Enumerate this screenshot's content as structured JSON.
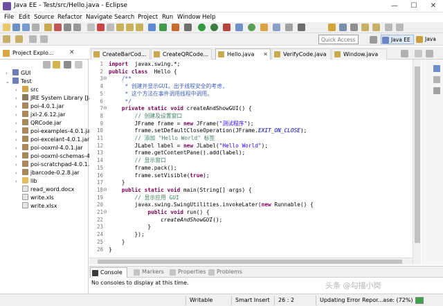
{
  "window": {
    "title": "Java EE - Test/src/Hello.java - Eclipse",
    "min": "—",
    "max": "☐",
    "close": "✕"
  },
  "menu": [
    "File",
    "Edit",
    "Source",
    "Refactor",
    "Navigate",
    "Search",
    "Project",
    "Run",
    "Window",
    "Help"
  ],
  "toolbar": {
    "quick_access_placeholder": "Quick Access",
    "perspectives": [
      "Java EE",
      "Java"
    ]
  },
  "package_explorer": {
    "title": "Project Explo...",
    "close": "✕",
    "tree": [
      {
        "label": "GUI",
        "arrow": "›",
        "icon": "project-icon"
      },
      {
        "label": "Test",
        "arrow": "⌄",
        "icon": "project-icon"
      },
      {
        "label": "src",
        "arrow": "›",
        "icon": "source-folder-icon"
      },
      {
        "label": "JRE System Library [Ja",
        "arrow": "›",
        "icon": "library-icon"
      },
      {
        "label": "poi-4.0.1.jar",
        "arrow": "›",
        "icon": "jar-icon"
      },
      {
        "label": "jxl-2.6.12.jar",
        "arrow": "›",
        "icon": "jar-icon"
      },
      {
        "label": "QRCode.jar",
        "arrow": "›",
        "icon": "jar-icon"
      },
      {
        "label": "poi-examples-4.0.1.jar",
        "arrow": "›",
        "icon": "jar-icon"
      },
      {
        "label": "poi-excelant-4.0.1.jar",
        "arrow": "›",
        "icon": "jar-icon"
      },
      {
        "label": "poi-ooxml-4.0.1.jar",
        "arrow": "›",
        "icon": "jar-icon"
      },
      {
        "label": "poi-ooxml-schemas-4",
        "arrow": "›",
        "icon": "jar-icon"
      },
      {
        "label": "poi-scratchpad-4.0.1.ja",
        "arrow": "›",
        "icon": "jar-icon"
      },
      {
        "label": "jbarcode-0.2.8.jar",
        "arrow": "›",
        "icon": "jar-icon"
      },
      {
        "label": "lib",
        "arrow": "›",
        "icon": "folder-icon"
      },
      {
        "label": "read_word.docx",
        "arrow": "",
        "icon": "file-icon"
      },
      {
        "label": "write.xls",
        "arrow": "",
        "icon": "file-icon"
      },
      {
        "label": "write.xlsx",
        "arrow": "",
        "icon": "file-icon"
      }
    ]
  },
  "editor_tabs": [
    {
      "label": "CreateBarCod...",
      "active": false
    },
    {
      "label": "CreateQRCode...",
      "active": false
    },
    {
      "label": "Hello.java",
      "active": true,
      "close": "✕"
    },
    {
      "label": "VerifyCode.java",
      "active": false
    },
    {
      "label": "Window.java",
      "active": false
    }
  ],
  "code": {
    "line_numbers": [
      "1",
      "2",
      "3",
      "4",
      "5",
      "6",
      "7",
      "8",
      "9",
      "10",
      "11",
      "12",
      "13",
      "14",
      "15",
      "16",
      "17",
      "18",
      "19",
      "20",
      "21",
      "22",
      "23",
      "24",
      "25",
      "26"
    ],
    "fold_markers": [
      "",
      "",
      "⊖",
      "",
      "",
      "",
      "⊖",
      "",
      "",
      "",
      "",
      "",
      "",
      "",
      "",
      "",
      "",
      "⊖",
      "",
      "",
      "⊖",
      "",
      "",
      "",
      "",
      ""
    ],
    "lines": [
      [
        [
          "kw",
          "import"
        ],
        [
          "",
          "  javax.swing.*;"
        ]
      ],
      [
        [
          "kw",
          "public class"
        ],
        [
          "",
          "  Hello {"
        ]
      ],
      [
        [
          "cm",
          "    /**"
        ]
      ],
      [
        [
          "cm",
          "     * 创建并显示GUI。出于线程安全的考虑,"
        ]
      ],
      [
        [
          "cm",
          "     * 这个方法在事件调用线程中调用。"
        ]
      ],
      [
        [
          "cm",
          "     */"
        ]
      ],
      [
        [
          "",
          "    "
        ],
        [
          "kw",
          "private static void"
        ],
        [
          "",
          " createAndShowGUI() {"
        ]
      ],
      [
        [
          "lc",
          "        // 创建及设置窗口"
        ]
      ],
      [
        [
          "",
          "        JFrame frame = "
        ],
        [
          "kw",
          "new"
        ],
        [
          "",
          " JFrame("
        ],
        [
          "st",
          "\"测试程序\""
        ],
        [
          "",
          ");"
        ]
      ],
      [
        [
          "",
          "        frame.setDefaultCloseOperation(JFrame."
        ],
        [
          "it",
          "EXIT_ON_CLOSE"
        ],
        [
          "",
          ");"
        ]
      ],
      [
        [
          "lc",
          "        // 添加 \"Hello World\" 标签"
        ]
      ],
      [
        [
          "",
          "        JLabel label = "
        ],
        [
          "kw",
          "new"
        ],
        [
          "",
          " JLabel("
        ],
        [
          "st",
          "\"Hello World\""
        ],
        [
          "",
          ");"
        ]
      ],
      [
        [
          "",
          "        frame.getContentPane().add(label);"
        ]
      ],
      [
        [
          "lc",
          "        // 显示窗口"
        ]
      ],
      [
        [
          "",
          "        frame.pack();"
        ]
      ],
      [
        [
          "",
          "        frame.setVisible("
        ],
        [
          "kw",
          "true"
        ],
        [
          "",
          ");"
        ]
      ],
      [
        [
          "",
          "    }"
        ]
      ],
      [
        [
          "",
          "    "
        ],
        [
          "kw",
          "public static void"
        ],
        [
          "",
          " main(String[] args) {"
        ]
      ],
      [
        [
          "lc",
          "        // 显示应用 GUI"
        ]
      ],
      [
        [
          "",
          "        javax.swing.SwingUtilities.invokeLater("
        ],
        [
          "kw",
          "new"
        ],
        [
          "",
          " Runnable() {"
        ]
      ],
      [
        [
          "",
          "            "
        ],
        [
          "kw",
          "public void"
        ],
        [
          "",
          " run() {"
        ]
      ],
      [
        [
          "",
          "                "
        ],
        [
          "mi",
          "createAndShowGUI"
        ],
        [
          "",
          "();"
        ]
      ],
      [
        [
          "",
          "            }"
        ]
      ],
      [
        [
          "",
          "        });"
        ]
      ],
      [
        [
          "",
          "    }"
        ]
      ],
      [
        [
          "",
          "}"
        ]
      ]
    ]
  },
  "console": {
    "tabs": [
      "Console",
      "Markers",
      "Properties",
      "Problems"
    ],
    "message": "No consoles to display at this time."
  },
  "status": {
    "mode": "Writable",
    "insert": "Smart Insert",
    "position": "26 : 2",
    "task": "Updating Error Repor...ase: (72%)"
  },
  "watermark": "头条 @勾描小岗",
  "colors": {
    "keyword": "#7f0055",
    "javadoc": "#3f5fbf",
    "comment": "#3f7f5f",
    "string": "#2a00ff",
    "constant": "#0000c0"
  }
}
